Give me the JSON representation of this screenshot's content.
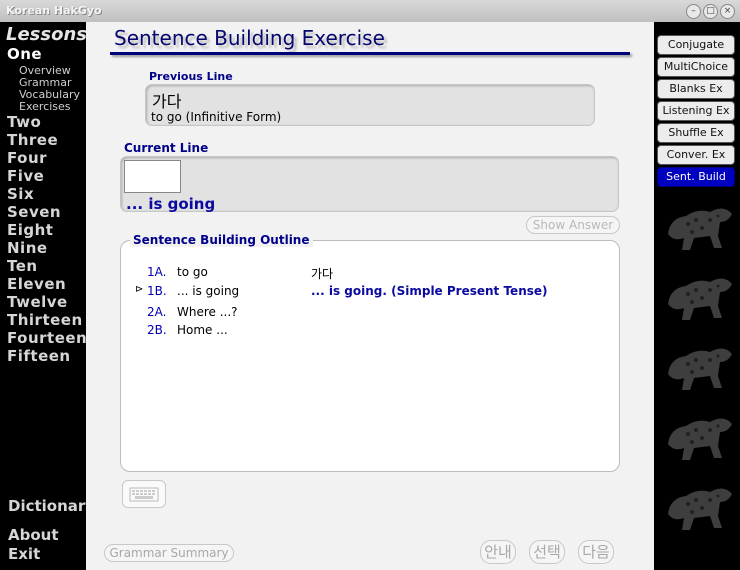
{
  "window": {
    "title": "Korean HakGyo"
  },
  "nav": {
    "heading": "Lessons",
    "lessons": [
      "One",
      "Two",
      "Three",
      "Four",
      "Five",
      "Six",
      "Seven",
      "Eight",
      "Nine",
      "Ten",
      "Eleven",
      "Twelve",
      "Thirteen",
      "Fourteen",
      "Fifteen"
    ],
    "active_lesson": "One",
    "subitems": [
      "Overview",
      "Grammar",
      "Vocabulary",
      "Exercises"
    ],
    "bottom": [
      "Dictionary",
      "About",
      "Exit"
    ]
  },
  "main": {
    "title": "Sentence Building Exercise",
    "previous": {
      "label": "Previous Line",
      "korean": "가다",
      "meaning": "to go (Infinitive Form)"
    },
    "current": {
      "label": "Current Line",
      "input_value": "",
      "text": "... is going"
    },
    "show_answer": "Show Answer",
    "outline": {
      "title": "Sentence Building Outline",
      "rows": [
        {
          "num": "1A.",
          "eng": "to go",
          "kor": "가다",
          "current": false
        },
        {
          "num": "1B.",
          "eng": "... is going",
          "kor": "... is going. (Simple Present Tense)",
          "current": true
        },
        {
          "num": "2A.",
          "eng": "Where ...?",
          "kor": "",
          "current": false
        },
        {
          "num": "2B.",
          "eng": "Home ...",
          "kor": "",
          "current": false
        }
      ]
    },
    "grammar_summary": "Grammar Summary",
    "korean_buttons": [
      "안내",
      "선택",
      "다음"
    ]
  },
  "right": {
    "buttons": [
      "Conjugate",
      "MultiChoice",
      "Blanks Ex",
      "Listening Ex",
      "Shuffle Ex",
      "Conver. Ex",
      "Sent. Build"
    ],
    "active": "Sent. Build"
  },
  "colors": {
    "accent": "#00008a",
    "active_tab": "#0000c0"
  }
}
